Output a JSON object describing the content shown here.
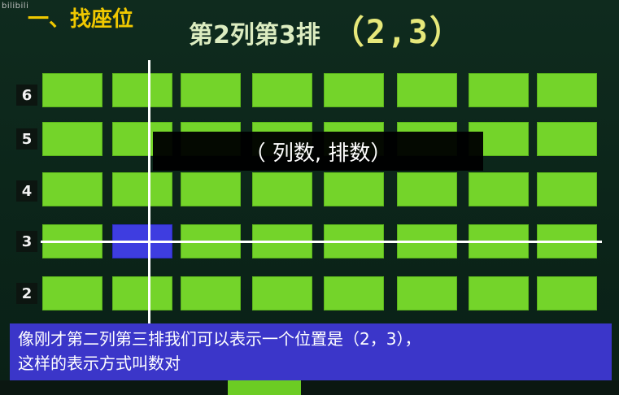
{
  "watermark": "bilibili",
  "heading": "一、找座位",
  "title": {
    "text": "第2列第3排",
    "coord": "（2,3）"
  },
  "overlay_text": "（ 列数, 排数）",
  "row_labels": [
    "6",
    "5",
    "4",
    "3",
    "2"
  ],
  "highlight": {
    "column": "2",
    "row": "3"
  },
  "subtitle": {
    "line1": "像刚才第二列第三排我们可以表示一个位置是（2，3），",
    "line2": "这样的表示方式叫数对"
  },
  "colors": {
    "seat": "#74d42a",
    "highlight": "#3e3de0",
    "board": "#0f2a1d",
    "subtitle_bg": "#3b36c9",
    "heading": "#f0c800"
  }
}
